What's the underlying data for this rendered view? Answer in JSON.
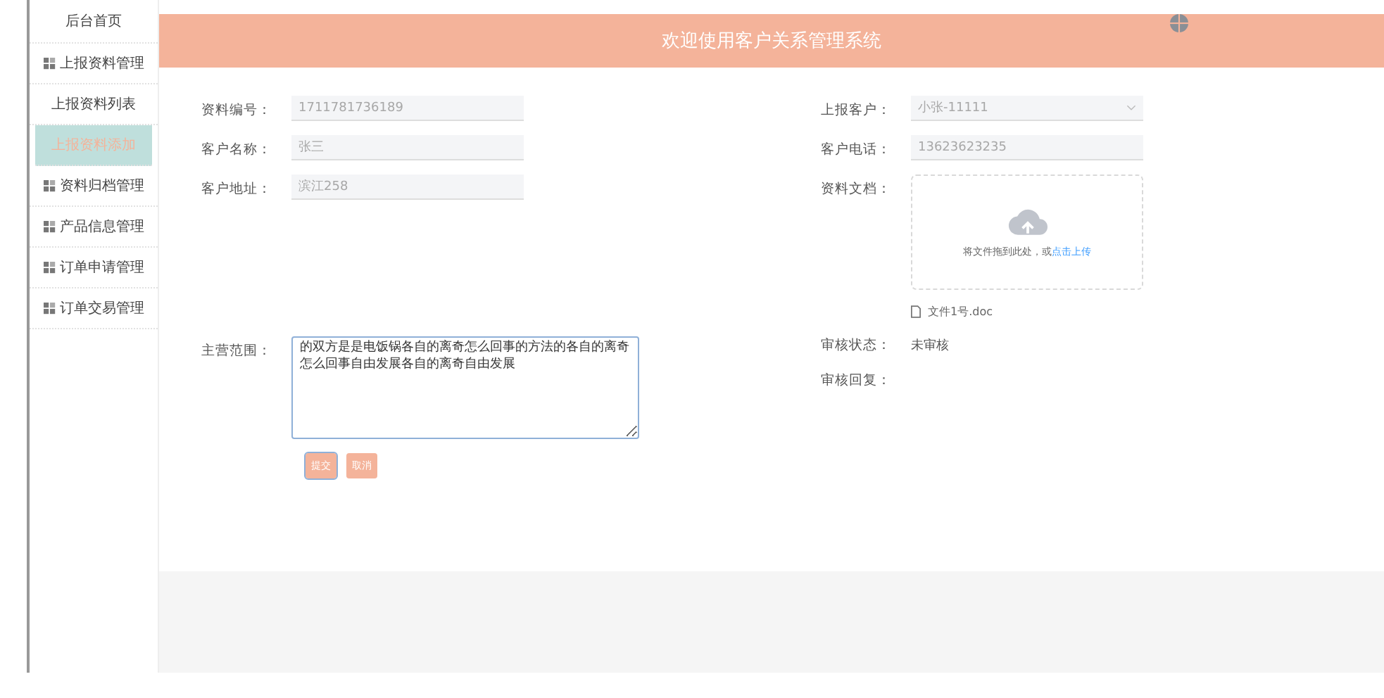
{
  "sidebar": {
    "items": [
      {
        "label": "后台首页",
        "icon": false,
        "selected": false
      },
      {
        "label": "上报资料管理",
        "icon": true,
        "selected": false
      },
      {
        "label": "上报资料列表",
        "icon": false,
        "selected": false
      },
      {
        "label": "上报资料添加",
        "icon": false,
        "selected": true
      },
      {
        "label": "资料归档管理",
        "icon": true,
        "selected": false
      },
      {
        "label": "产品信息管理",
        "icon": true,
        "selected": false
      },
      {
        "label": "订单申请管理",
        "icon": true,
        "selected": false
      },
      {
        "label": "订单交易管理",
        "icon": true,
        "selected": false
      }
    ]
  },
  "header": {
    "title": "欢迎使用客户关系管理系统"
  },
  "form": {
    "left": [
      {
        "label": "资料编号：",
        "value": "1711781736189"
      },
      {
        "label": "客户名称：",
        "value": "张三"
      },
      {
        "label": "客户地址：",
        "value": "滨江258"
      }
    ],
    "right": [
      {
        "label": "上报客户：",
        "value": "小张-11111",
        "kind": "select"
      },
      {
        "label": "客户电话：",
        "value": "13623623235",
        "kind": "input"
      }
    ],
    "upload": {
      "label": "资料文档：",
      "hint": "将文件拖到此处，或",
      "link": "点击上传",
      "file": "文件1号.doc"
    },
    "scope": {
      "label": "主营范围：",
      "value": "的双方是是电饭锅各自的离奇怎么回事的方法的各自的离奇怎么回事自由发展各自的离奇自由发展"
    },
    "review_status": {
      "label": "审核状态：",
      "value": "未审核"
    },
    "review_reply": {
      "label": "审核回复："
    },
    "buttons": [
      "提交",
      "取消"
    ]
  }
}
